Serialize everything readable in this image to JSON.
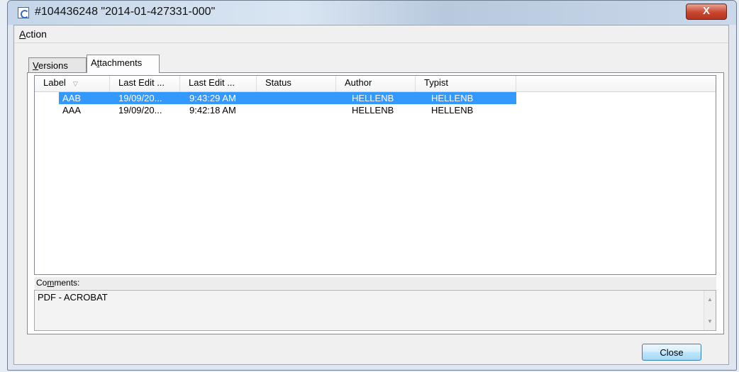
{
  "window": {
    "title": "#104436248 \"2014-01-427331-000\"",
    "close_glyph": "X",
    "icon": "app-icon"
  },
  "menubar": {
    "items": [
      {
        "label": "Action",
        "mnemonic": "A",
        "rest": "ction"
      }
    ]
  },
  "tabs": [
    {
      "label": "Versions",
      "mnemonic": "V",
      "rest": "ersions",
      "active": false
    },
    {
      "label": "Attachments",
      "pre": "A",
      "mnemonic": "t",
      "rest": "tachments",
      "active": true
    }
  ],
  "listview": {
    "columns": [
      "Label",
      "Last Edit ...",
      "Last Edit ...",
      "Status",
      "Author",
      "Typist"
    ],
    "sort_icon": "sort-down-icon",
    "rows": [
      {
        "label": "AAB",
        "date": "19/09/20...",
        "time": "9:43:29 AM",
        "status": "",
        "author": "HELLENB",
        "typist": "HELLENB",
        "selected": true
      },
      {
        "label": "AAA",
        "date": "19/09/20...",
        "time": "9:42:18 AM",
        "status": "",
        "author": "HELLENB",
        "typist": "HELLENB",
        "selected": false
      }
    ]
  },
  "comments": {
    "label": "Comments:",
    "pre": "Co",
    "mnemonic": "m",
    "rest": "ments:",
    "value": "PDF - ACROBAT"
  },
  "buttons": {
    "close": "Close"
  },
  "colors": {
    "selection": "#3399ff",
    "close_x": "#c9452f"
  }
}
